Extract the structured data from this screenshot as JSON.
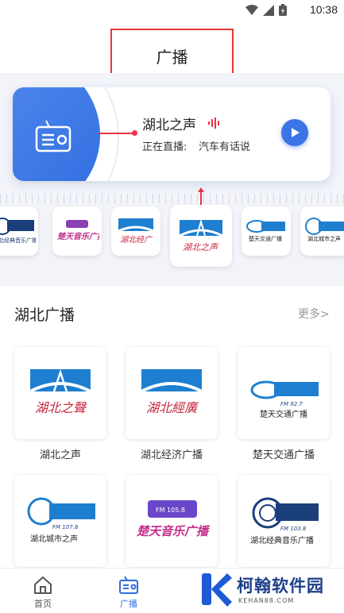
{
  "status_bar": {
    "time": "10:38",
    "icons": [
      "wifi-icon",
      "signal-icon",
      "battery-icon"
    ]
  },
  "header": {
    "title": "广播"
  },
  "player": {
    "station": "湖北之声",
    "live_label": "正在直播:",
    "program": "汽车有话说",
    "accent": "#3b74e6"
  },
  "carousel": [
    {
      "logo_text": "湖北经典音乐广播"
    },
    {
      "logo_text": "楚天音乐广播"
    },
    {
      "logo_text": "湖北经广"
    },
    {
      "logo_text": "湖北之声",
      "selected": true
    },
    {
      "logo_text": "楚天交通广播"
    },
    {
      "logo_text": "湖北城市之声"
    }
  ],
  "section": {
    "title": "湖北广播",
    "more": "更多>"
  },
  "stations": [
    {
      "label": "湖北之声",
      "logo_text": "湖北之聲"
    },
    {
      "label": "湖北经济广播",
      "logo_text": "湖北經廣"
    },
    {
      "label": "楚天交通广播",
      "logo_text": "楚天交通广播",
      "freq": "FM 92.7"
    },
    {
      "label": "",
      "logo_text": "湖北城市之声",
      "freq": "FM 107.8"
    },
    {
      "label": "",
      "logo_text": "楚天音乐广播",
      "freq": "FM 105.8"
    },
    {
      "label": "",
      "logo_text": "湖北经典音乐广播",
      "freq": "FM 103.8"
    }
  ],
  "tabbar": {
    "tabs": [
      {
        "label": "首页",
        "icon": "home-icon"
      },
      {
        "label": "广播",
        "icon": "radio-icon",
        "active": true
      }
    ]
  },
  "watermark": {
    "text": "柯翰软件园",
    "sub": "KEHAN88.COM"
  }
}
